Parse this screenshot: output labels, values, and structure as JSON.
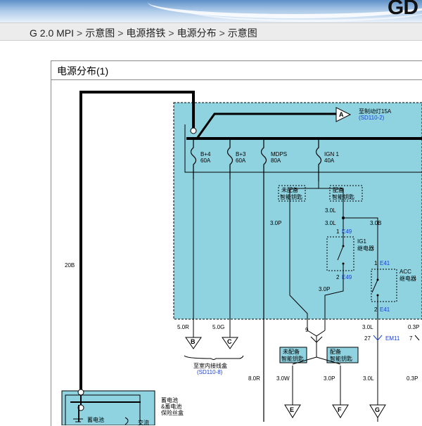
{
  "header": {
    "logo_text": "GD"
  },
  "breadcrumb": {
    "items": [
      "G 2.0 MPI",
      "示意图",
      "电源搭铁",
      "电源分布",
      "示意图"
    ],
    "separator": ">"
  },
  "panel": {
    "title": "电源分布(1)"
  },
  "diagram": {
    "top_connector": {
      "letter": "A",
      "label": "至制动灯15A",
      "ref": "(SD110-2)"
    },
    "fuses": [
      {
        "name": "B+4",
        "rating": "60A"
      },
      {
        "name": "B+3",
        "rating": "60A"
      },
      {
        "name": "MDPS",
        "rating": "80A"
      },
      {
        "name": "IGN 1",
        "rating": "40A"
      }
    ],
    "wire_20b": "20B",
    "smartkey_no": "未配备\n智能钥匙",
    "smartkey_yes": "配备\n智能钥匙",
    "w_30l_a": "3.0L",
    "w_30l_b": "3.0L",
    "w_30b": "3.0B",
    "w_30p_a": "3.0P",
    "w_30p_b": "3.0P",
    "ig1_relay": {
      "pin1": "1",
      "conn1": "E49",
      "name1": "IG1",
      "name2": "继电器",
      "pin2": "2",
      "conn2": "E49"
    },
    "acc_relay": {
      "pin1": "1",
      "conn1": "E41",
      "name1": "ACC",
      "name2": "继电器",
      "pin2": "2",
      "conn2": "E41"
    },
    "w_50r": "5.0R",
    "w_50g": "5.0G",
    "conn_b": "B",
    "conn_c": "C",
    "indoor_box": "至室内接线盒",
    "indoor_ref": "(SD110-8)",
    "w_30l_c": "3.0L",
    "w_03p_a": "0.3P",
    "pin9": "9",
    "pin27": "27",
    "em11": "EM11",
    "pin7": "7",
    "w_80r": "8.0R",
    "w_30w": "3.0W",
    "w_30p_c": "3.0P",
    "w_30l_d": "3.0L",
    "w_03p_b": "0.3P",
    "conn_e": "E",
    "conn_f": "F",
    "conn_g": "G",
    "battery_box": "蓄电池\n&蓄电池\n保险丝盒",
    "battery": "蓄电池",
    "ac": "交流"
  }
}
